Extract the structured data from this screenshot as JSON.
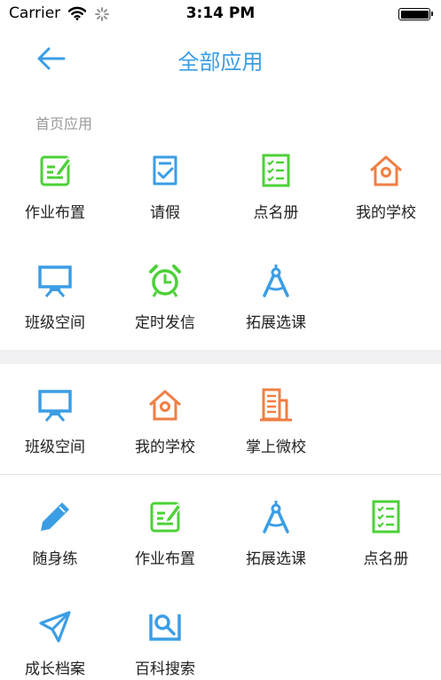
{
  "status_bar": {
    "carrier": "Carrier",
    "time": "3:14 PM"
  },
  "nav": {
    "title": "全部应用"
  },
  "sections": {
    "home": {
      "label": "首页应用",
      "items": [
        {
          "label": "作业布置",
          "icon": "homework-edit-icon"
        },
        {
          "label": "请假",
          "icon": "leave-request-icon"
        },
        {
          "label": "点名册",
          "icon": "roll-call-icon"
        },
        {
          "label": "我的学校",
          "icon": "my-school-icon"
        },
        {
          "label": "班级空间",
          "icon": "class-space-icon"
        },
        {
          "label": "定时发信",
          "icon": "alarm-clock-icon"
        },
        {
          "label": "拓展选课",
          "icon": "compass-icon"
        }
      ]
    },
    "group2": {
      "items": [
        {
          "label": "班级空间",
          "icon": "class-space-icon"
        },
        {
          "label": "我的学校",
          "icon": "my-school-icon"
        },
        {
          "label": "掌上微校",
          "icon": "building-icon"
        }
      ]
    },
    "group3": {
      "items": [
        {
          "label": "随身练",
          "icon": "pen-icon"
        },
        {
          "label": "作业布置",
          "icon": "homework-edit-icon"
        },
        {
          "label": "拓展选课",
          "icon": "compass-icon"
        },
        {
          "label": "点名册",
          "icon": "roll-call-icon"
        },
        {
          "label": "成长档案",
          "icon": "paper-plane-icon"
        },
        {
          "label": "百科搜索",
          "icon": "search-doc-icon"
        }
      ]
    }
  },
  "colors": {
    "blue": "#3b9ee5",
    "green": "#4cd137",
    "orange": "#ef7f44"
  }
}
